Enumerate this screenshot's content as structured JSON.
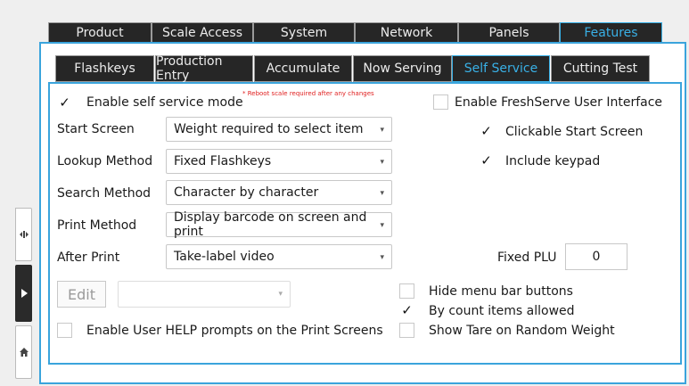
{
  "top_tabs": [
    {
      "label": "Product",
      "active": false
    },
    {
      "label": "Scale Access",
      "active": false
    },
    {
      "label": "System",
      "active": false
    },
    {
      "label": "Network",
      "active": false
    },
    {
      "label": "Panels",
      "active": false
    },
    {
      "label": "Features",
      "active": true
    }
  ],
  "sub_tabs": [
    {
      "label": "Flashkeys",
      "active": false
    },
    {
      "label": "Production Entry",
      "active": false
    },
    {
      "label": "Accumulate",
      "active": false
    },
    {
      "label": "Now Serving",
      "active": false
    },
    {
      "label": "Self Service",
      "active": true
    },
    {
      "label": "Cutting Test",
      "active": false
    }
  ],
  "form": {
    "enable_self_service": {
      "label": "Enable self service mode",
      "checked": true
    },
    "reboot_note": "* Reboot scale required after any changes",
    "enable_freshserve": {
      "label": "Enable FreshServe User Interface",
      "checked": false
    },
    "start_screen": {
      "label": "Start Screen",
      "value": "Weight required to select item"
    },
    "lookup_method": {
      "label": "Lookup Method",
      "value": "Fixed Flashkeys"
    },
    "search_method": {
      "label": "Search Method",
      "value": "Character by character"
    },
    "print_method": {
      "label": "Print Method",
      "value": "Display barcode on screen and print"
    },
    "after_print": {
      "label": "After Print",
      "value": "Take-label video"
    },
    "clickable_start": {
      "label": "Clickable Start Screen",
      "checked": true
    },
    "include_keypad": {
      "label": "Include keypad",
      "checked": true
    },
    "fixed_plu": {
      "label": "Fixed PLU",
      "value": "0"
    },
    "edit_button": "Edit",
    "edit_select_value": "",
    "hide_menu_bar": {
      "label": "Hide menu bar buttons",
      "checked": false
    },
    "by_count": {
      "label": "By count items allowed",
      "checked": true
    },
    "show_tare": {
      "label": "Show Tare on Random Weight",
      "checked": false
    },
    "enable_help": {
      "label": "Enable User HELP prompts on the Print Screens",
      "checked": false
    }
  },
  "colors": {
    "accent": "#3aa4dc",
    "tab_bg": "#262626",
    "active_text": "#39b0e6"
  },
  "check_glyph": "✓",
  "dropdown_glyph": "▾",
  "icons": {
    "side_top": "scale-icon",
    "side_mid": "play-arrow-icon",
    "side_bottom": "home-icon"
  }
}
